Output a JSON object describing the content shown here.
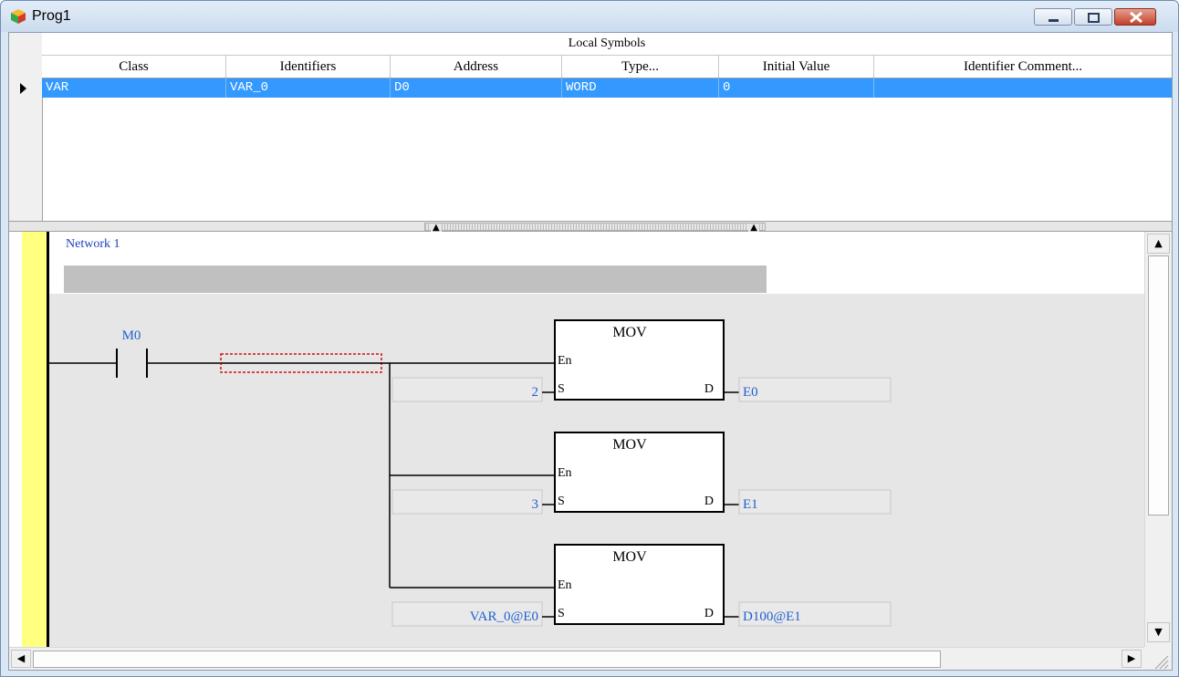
{
  "window": {
    "title": "Prog1"
  },
  "grid": {
    "group_header": "Local Symbols",
    "columns": [
      "Class",
      "Identifiers",
      "Address",
      "Type...",
      "Initial Value",
      "Identifier Comment..."
    ],
    "rows": [
      {
        "class": "VAR",
        "identifier": "VAR_0",
        "address": "D0",
        "type": "WORD",
        "initial_value": "0",
        "comment": ""
      }
    ]
  },
  "network": {
    "label": "Network 1",
    "contact": {
      "label": "M0"
    },
    "blocks": [
      {
        "name": "MOV",
        "en": "En",
        "s": "S",
        "d": "D",
        "s_value": "2",
        "d_value": "E0"
      },
      {
        "name": "MOV",
        "en": "En",
        "s": "S",
        "d": "D",
        "s_value": "3",
        "d_value": "E1"
      },
      {
        "name": "MOV",
        "en": "En",
        "s": "S",
        "d": "D",
        "s_value": "VAR_0@E0",
        "d_value": "D100@E1"
      }
    ]
  },
  "colors": {
    "selection": "#3399ff",
    "operand_text": "#2060d0",
    "power_rail": "#ffff80",
    "network_label": "#1f3fc0"
  }
}
